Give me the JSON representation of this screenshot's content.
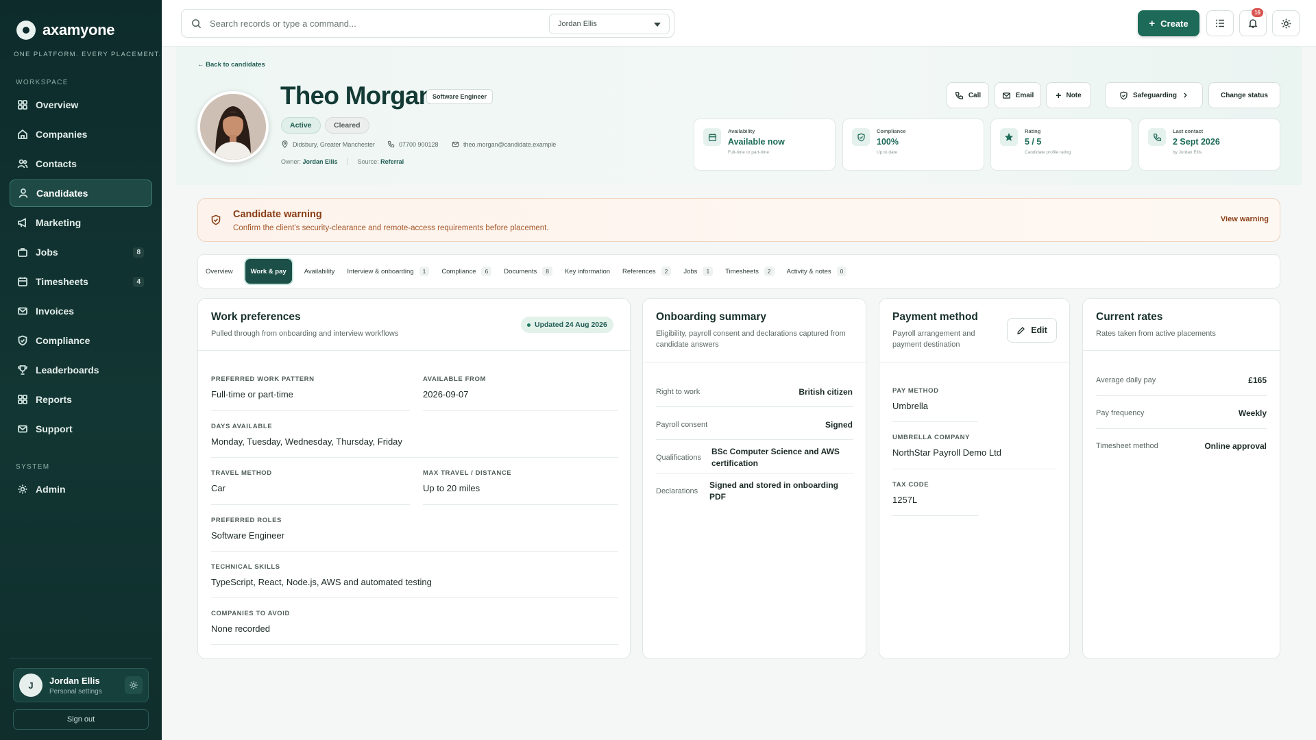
{
  "brand": {
    "name": "axamyone",
    "tagline": "ONE PLATFORM. EVERY PLACEMENT."
  },
  "sidebar": {
    "workspace_label": "WORKSPACE",
    "system_label": "SYSTEM",
    "items": [
      {
        "label": "Overview",
        "icon": "grid-icon"
      },
      {
        "label": "Companies",
        "icon": "home-icon"
      },
      {
        "label": "Contacts",
        "icon": "contacts-icon"
      },
      {
        "label": "Candidates",
        "icon": "person-icon",
        "active": true
      },
      {
        "label": "Marketing",
        "icon": "megaphone-icon"
      },
      {
        "label": "Jobs",
        "icon": "briefcase-icon",
        "count": "8"
      },
      {
        "label": "Timesheets",
        "icon": "calendar-icon",
        "count": "4"
      },
      {
        "label": "Invoices",
        "icon": "mail-icon"
      },
      {
        "label": "Compliance",
        "icon": "shield-icon"
      },
      {
        "label": "Leaderboards",
        "icon": "trophy-icon"
      },
      {
        "label": "Reports",
        "icon": "chart-icon"
      },
      {
        "label": "Support",
        "icon": "support-icon"
      }
    ],
    "admin_label": "Admin",
    "user": {
      "initial": "J",
      "name": "Jordan Ellis",
      "sub": "Personal settings"
    },
    "signout": "Sign out"
  },
  "topbar": {
    "search_placeholder": "Search records or type a command...",
    "owner_select": "Jordan Ellis",
    "create_label": "Create",
    "notification_count": "16"
  },
  "candidate": {
    "back": "← Back to candidates",
    "name": "Theo Morgan",
    "role": "Software Engineer",
    "status_active": "Active",
    "status_cleared": "Cleared",
    "location": "Didsbury, Greater Manchester",
    "phone": "07700 900128",
    "email": "theo.morgan@candidate.example",
    "owner_label": "Owner:",
    "owner": "Jordan Ellis",
    "source_label": "Source:",
    "source": "Referral"
  },
  "actions": {
    "call": "Call",
    "email": "Email",
    "note": "Note",
    "safeguarding": "Safeguarding",
    "change_status": "Change status"
  },
  "stats": [
    {
      "label": "Availability",
      "value": "Available now",
      "sub": "Full-time or part-time"
    },
    {
      "label": "Compliance",
      "value": "100%",
      "sub": "Up to date"
    },
    {
      "label": "Rating",
      "value": "5 / 5",
      "sub": "Candidate profile rating"
    },
    {
      "label": "Last contact",
      "value": "2 Sept 2026",
      "sub": "by Jordan Ellis"
    }
  ],
  "warning": {
    "title": "Candidate warning",
    "text": "Confirm the client's security-clearance and remote-access requirements before placement.",
    "link": "View warning"
  },
  "tabs": [
    {
      "label": "Overview"
    },
    {
      "label": "Work & pay",
      "active": true
    },
    {
      "label": "Availability"
    },
    {
      "label": "Interview & onboarding",
      "count": "1"
    },
    {
      "label": "Compliance",
      "count": "6"
    },
    {
      "label": "Documents",
      "count": "8"
    },
    {
      "label": "Key information"
    },
    {
      "label": "References",
      "count": "2"
    },
    {
      "label": "Jobs",
      "count": "1"
    },
    {
      "label": "Timesheets",
      "count": "2"
    },
    {
      "label": "Activity & notes",
      "count": "0"
    }
  ],
  "work_preferences": {
    "title": "Work preferences",
    "subtitle": "Pulled through from onboarding and interview workflows",
    "updated": "Updated 24 Aug 2026",
    "fields": {
      "pattern_label": "PREFERRED WORK PATTERN",
      "pattern": "Full-time or part-time",
      "available_label": "AVAILABLE FROM",
      "available": "2026-09-07",
      "days_label": "DAYS AVAILABLE",
      "days": "Monday, Tuesday, Wednesday, Thursday, Friday",
      "travel_label": "TRAVEL METHOD",
      "travel": "Car",
      "distance_label": "MAX TRAVEL / DISTANCE",
      "distance": "Up to 20 miles",
      "roles_label": "PREFERRED ROLES",
      "roles": "Software Engineer",
      "skills_label": "TECHNICAL SKILLS",
      "skills": "TypeScript, React, Node.js, AWS and automated testing",
      "avoid_label": "COMPANIES TO AVOID",
      "avoid": "None recorded"
    }
  },
  "onboarding": {
    "title": "Onboarding summary",
    "subtitle": "Eligibility, payroll consent and declarations captured from candidate answers",
    "rows": [
      {
        "label": "Right to work",
        "value": "British citizen"
      },
      {
        "label": "Payroll consent",
        "value": "Signed"
      },
      {
        "label": "Qualifications",
        "value": "BSc Computer Science and AWS certification"
      },
      {
        "label": "Declarations",
        "value": "Signed and stored in onboarding PDF"
      }
    ]
  },
  "payment": {
    "title": "Payment method",
    "subtitle": "Payroll arrangement and payment destination",
    "edit": "Edit",
    "method_label": "PAY METHOD",
    "method": "Umbrella",
    "company_label": "UMBRELLA COMPANY",
    "company": "NorthStar Payroll Demo Ltd",
    "tax_label": "TAX CODE",
    "tax": "1257L"
  },
  "rates": {
    "title": "Current rates",
    "subtitle": "Rates taken from active placements",
    "rows": [
      {
        "label": "Average daily pay",
        "value": "£165"
      },
      {
        "label": "Pay frequency",
        "value": "Weekly"
      },
      {
        "label": "Timesheet method",
        "value": "Online approval"
      }
    ]
  }
}
